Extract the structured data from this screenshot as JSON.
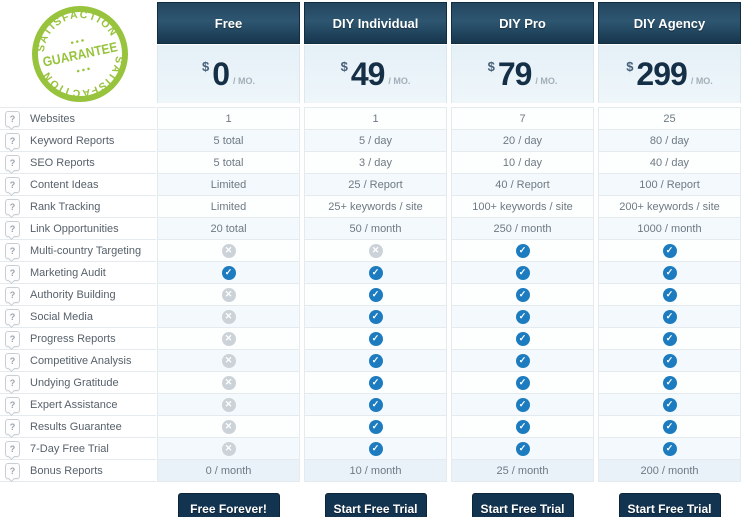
{
  "badge": {
    "arc_top": "SATISFACTION",
    "center": "GUARANTEE",
    "arc_bottom": "SATISFACTION",
    "dots": "● ● ●",
    "color": "#98c33d"
  },
  "icons": {
    "help_glyph": "?",
    "check_glyph": "✓",
    "cross_glyph": "✕"
  },
  "colors": {
    "header_bg": "#24465f",
    "price_bg": "#e8f2f9",
    "check_blue": "#1d7cc0",
    "cross_gray": "#ccd3d8",
    "button_bg": "#133450",
    "badge_green": "#98c33d"
  },
  "plans": [
    {
      "name": "Free",
      "currency": "$",
      "amount": "0",
      "period": "/ MO.",
      "button_label": "Free Forever!"
    },
    {
      "name": "DIY Individual",
      "currency": "$",
      "amount": "49",
      "period": "/ MO.",
      "button_label": "Start Free Trial"
    },
    {
      "name": "DIY Pro",
      "currency": "$",
      "amount": "79",
      "period": "/ MO.",
      "button_label": "Start Free Trial"
    },
    {
      "name": "DIY Agency",
      "currency": "$",
      "amount": "299",
      "period": "/ MO.",
      "button_label": "Start Free Trial"
    }
  ],
  "features": [
    {
      "label": "Websites",
      "values": [
        "1",
        "1",
        "7",
        "25"
      ]
    },
    {
      "label": "Keyword Reports",
      "values": [
        "5 total",
        "5 / day",
        "20 / day",
        "80 / day"
      ]
    },
    {
      "label": "SEO Reports",
      "values": [
        "5 total",
        "3 / day",
        "10 / day",
        "40 / day"
      ]
    },
    {
      "label": "Content Ideas",
      "values": [
        "Limited",
        "25 / Report",
        "40 / Report",
        "100 / Report"
      ]
    },
    {
      "label": "Rank Tracking",
      "values": [
        "Limited",
        "25+ keywords / site",
        "100+ keywords / site",
        "200+ keywords / site"
      ]
    },
    {
      "label": "Link Opportunities",
      "values": [
        "20 total",
        "50 / month",
        "250 / month",
        "1000 / month"
      ]
    },
    {
      "label": "Multi-country Targeting",
      "values": [
        "no",
        "no",
        "yes",
        "yes"
      ]
    },
    {
      "label": "Marketing Audit",
      "values": [
        "yes",
        "yes",
        "yes",
        "yes"
      ]
    },
    {
      "label": "Authority Building",
      "values": [
        "no",
        "yes",
        "yes",
        "yes"
      ]
    },
    {
      "label": "Social Media",
      "values": [
        "no",
        "yes",
        "yes",
        "yes"
      ]
    },
    {
      "label": "Progress Reports",
      "values": [
        "no",
        "yes",
        "yes",
        "yes"
      ]
    },
    {
      "label": "Competitive Analysis",
      "values": [
        "no",
        "yes",
        "yes",
        "yes"
      ]
    },
    {
      "label": "Undying Gratitude",
      "values": [
        "no",
        "yes",
        "yes",
        "yes"
      ]
    },
    {
      "label": "Expert Assistance",
      "values": [
        "no",
        "yes",
        "yes",
        "yes"
      ]
    },
    {
      "label": "Results Guarantee",
      "values": [
        "no",
        "yes",
        "yes",
        "yes"
      ]
    },
    {
      "label": "7-Day Free Trial",
      "values": [
        "no",
        "yes",
        "yes",
        "yes"
      ]
    },
    {
      "label": "Bonus Reports",
      "values": [
        "0 / month",
        "10 / month",
        "25 / month",
        "200 / month"
      ]
    }
  ]
}
